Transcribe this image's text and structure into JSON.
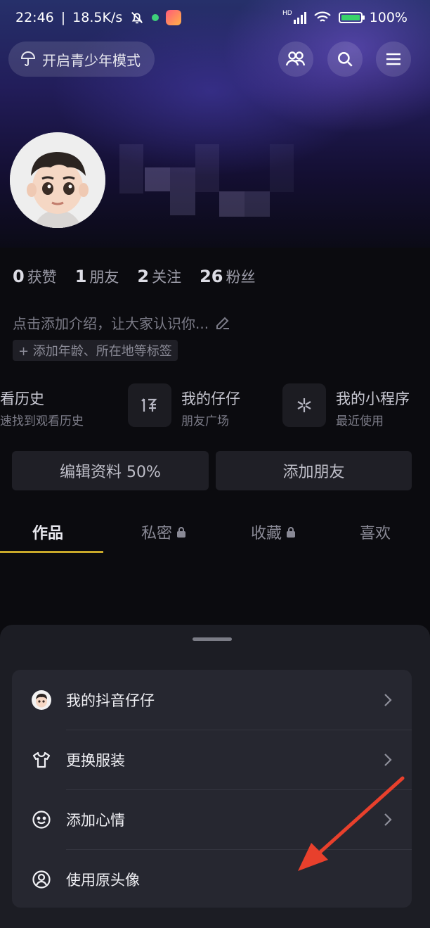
{
  "status_bar": {
    "time": "22:46",
    "network_speed": "18.5K/s",
    "network_badge": "HD",
    "battery": "100%"
  },
  "header": {
    "teen_mode_label": "开启青少年模式"
  },
  "profile": {
    "stats": [
      {
        "count": "0",
        "label": "获赞"
      },
      {
        "count": "1",
        "label": "朋友"
      },
      {
        "count": "2",
        "label": "关注"
      },
      {
        "count": "26",
        "label": "粉丝"
      }
    ],
    "bio_placeholder": "点击添加介绍，让大家认识你...",
    "tag_prompt": "+ 添加年龄、所在地等标签"
  },
  "tools": [
    {
      "title": "看历史",
      "subtitle": "速找到观看历史"
    },
    {
      "title": "我的仔仔",
      "subtitle": "朋友广场"
    },
    {
      "title": "我的小程序",
      "subtitle": "最近使用"
    }
  ],
  "actions": {
    "edit_profile": "编辑资料 50%",
    "add_friends": "添加朋友"
  },
  "tabs": [
    {
      "label": "作品",
      "active": true,
      "locked": false
    },
    {
      "label": "私密",
      "active": false,
      "locked": true
    },
    {
      "label": "收藏",
      "active": false,
      "locked": true
    },
    {
      "label": "喜欢",
      "active": false,
      "locked": false
    }
  ],
  "sheet": {
    "items": [
      {
        "label": "我的抖音仔仔",
        "icon": "avatar-icon",
        "has_chevron": true
      },
      {
        "label": "更换服装",
        "icon": "shirt-icon",
        "has_chevron": true
      },
      {
        "label": "添加心情",
        "icon": "smiley-icon",
        "has_chevron": true
      },
      {
        "label": "使用原头像",
        "icon": "user-circle-icon",
        "has_chevron": false
      }
    ]
  },
  "colors": {
    "accent_underline": "#c9a92a",
    "annotation_arrow": "#e8402c",
    "sheet_bg": "#1c1d24",
    "card_bg": "#262730"
  }
}
